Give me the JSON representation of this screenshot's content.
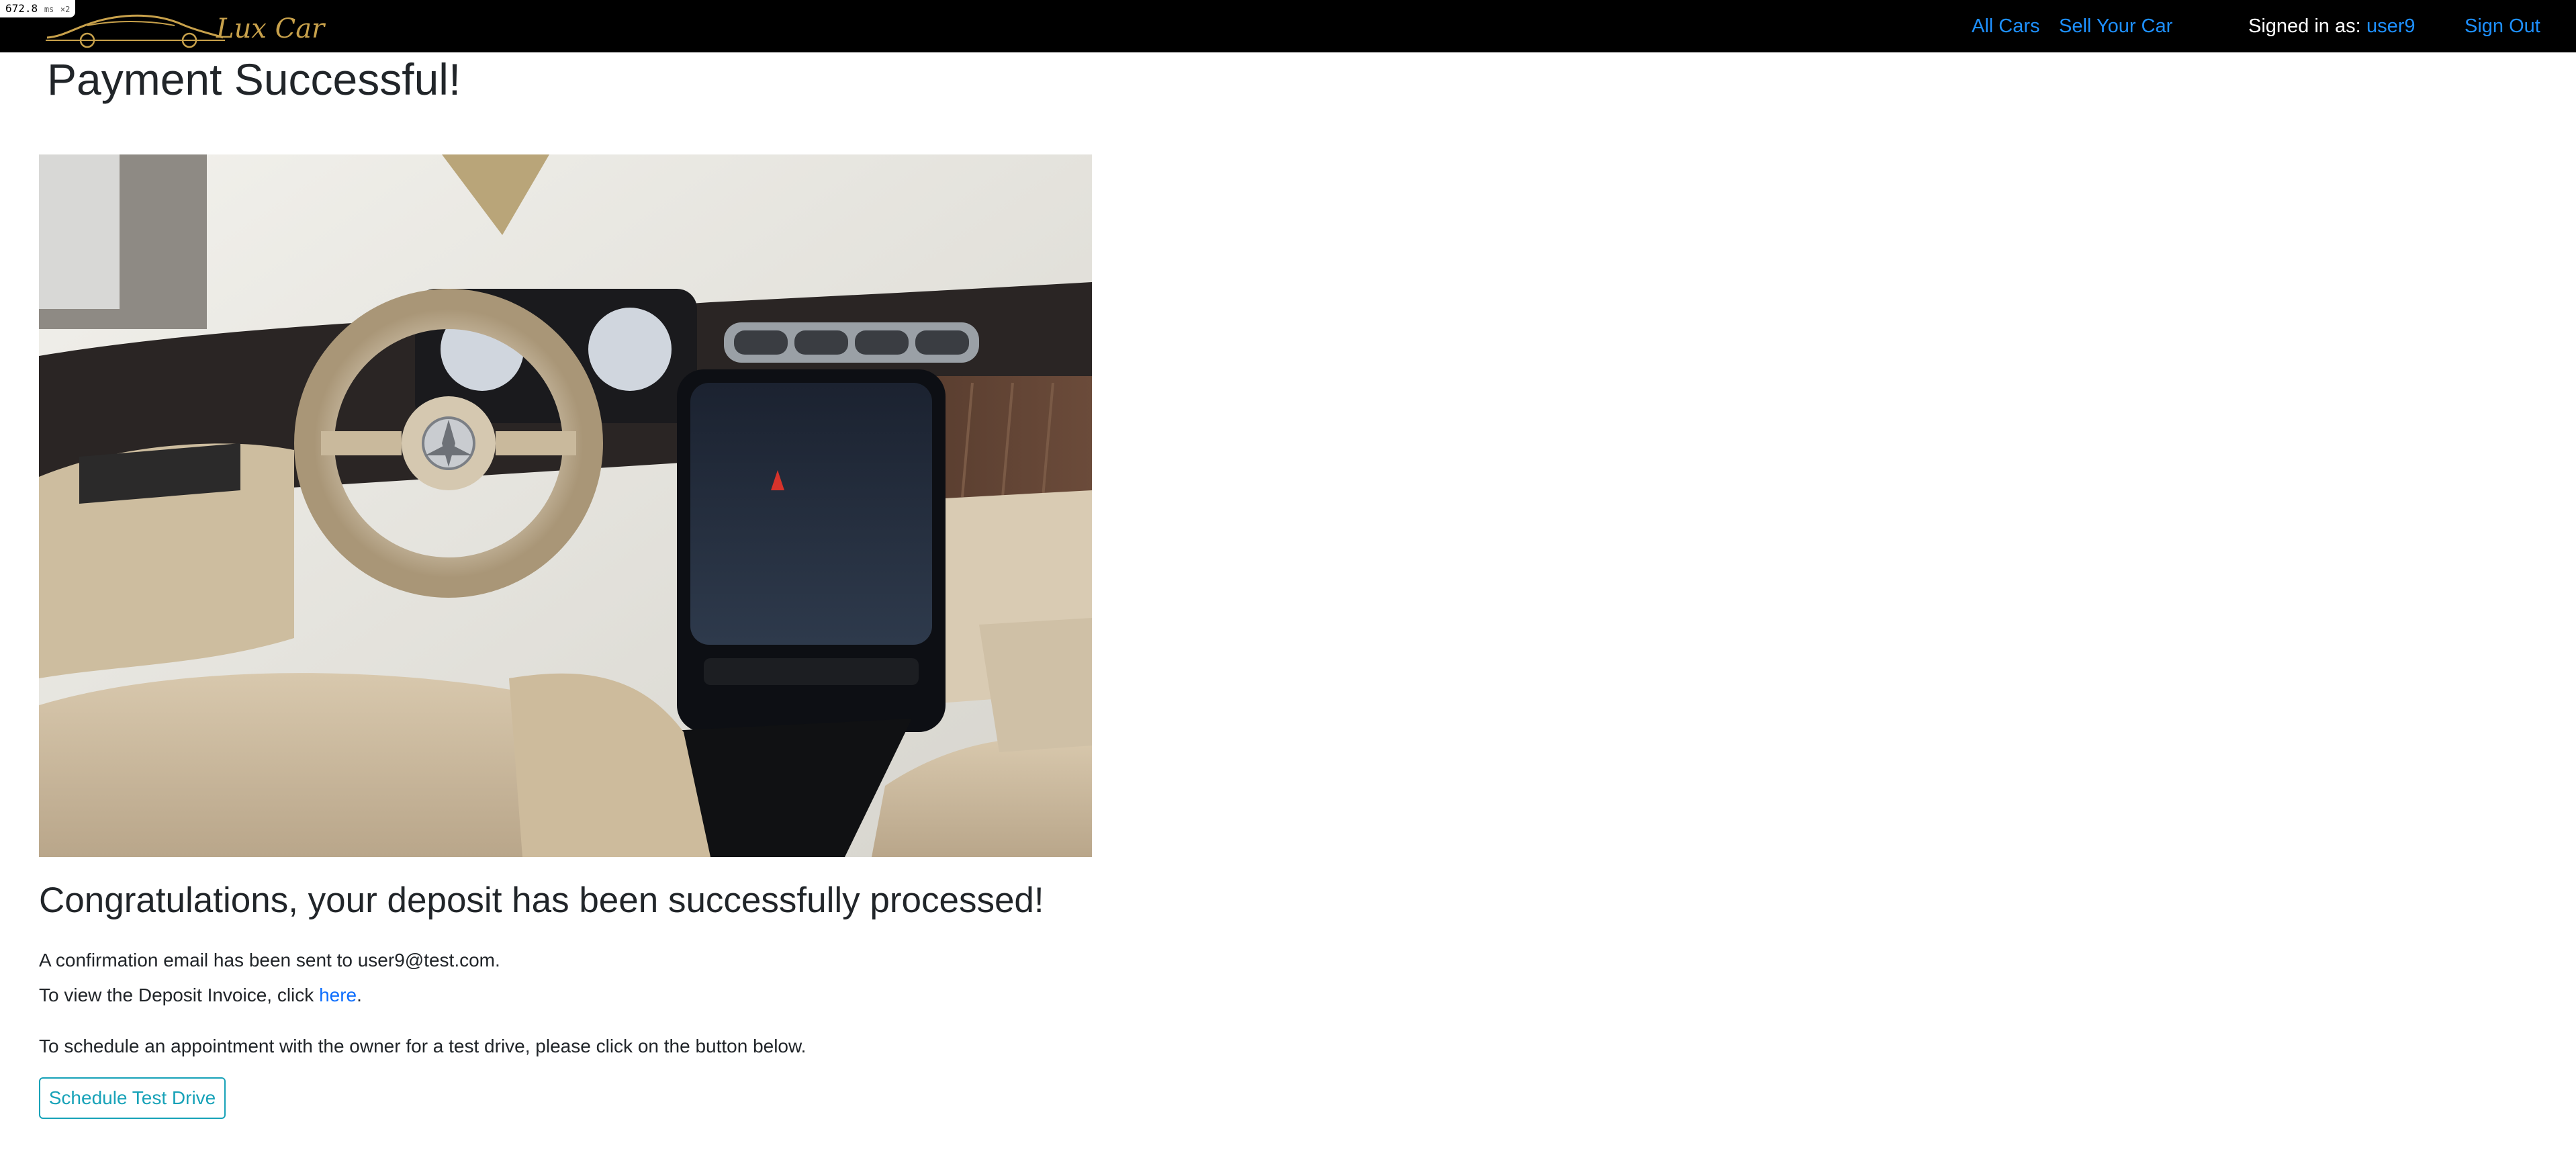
{
  "devtools": {
    "render_time": "672.8",
    "render_unit": "ms",
    "multiplier": "×2"
  },
  "nav": {
    "brand_text": "Lux Car",
    "all_cars": "All Cars",
    "sell_your_car": "Sell Your Car",
    "signed_in_label": "Signed in as:",
    "username": "user9",
    "sign_out": "Sign Out"
  },
  "page": {
    "title": "Payment Successful!",
    "image_icon": "car-interior-photo",
    "congrats": "Congratulations, your deposit has been successfully processed!",
    "confirmation_prefix": "A confirmation email has been sent to ",
    "confirmation_email": "user9@test.com",
    "confirmation_suffix": ".",
    "invoice_prefix": "To view the Deposit Invoice, click ",
    "invoice_link": "here",
    "invoice_suffix": ".",
    "schedule_text": "To schedule an appointment with the owner for a test drive, please click on the button below.",
    "schedule_button": "Schedule Test Drive"
  },
  "colors": {
    "navbar_bg": "#000000",
    "link": "#1e90ff",
    "brand_gold": "#c8a14b",
    "button_outline": "#17a2b8"
  }
}
